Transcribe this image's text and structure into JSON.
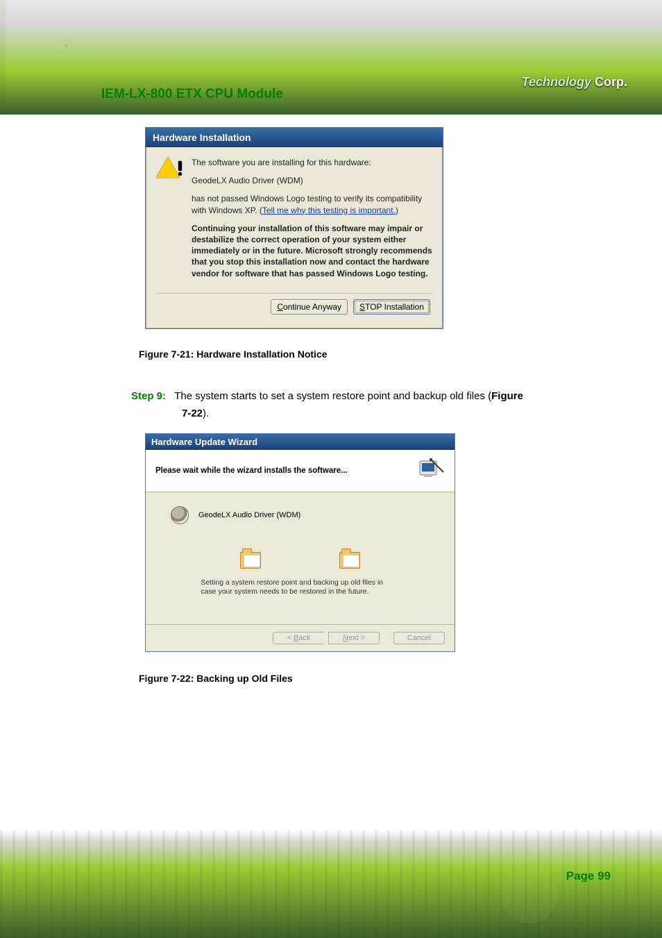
{
  "header": {
    "title": "IEM-LX-800 ETX CPU Module",
    "brand_prefix": "Technology",
    "brand_suffix": " Corp."
  },
  "dialog1": {
    "title": "Hardware Installation",
    "line1": "The software you are installing for this hardware:",
    "driver_name": "GeodeLX Audio Driver (WDM)",
    "line2a": "has not passed Windows Logo testing to verify its compatibility with Windows XP. (",
    "link": "Tell me why this testing is important.",
    "line2b": ")",
    "warning_bold": "Continuing your installation of this software may impair or destabilize the correct operation of your system either immediately or in the future. Microsoft strongly recommends that you stop this installation now and contact the hardware vendor for software that has passed Windows Logo testing.",
    "btn_continue": "Continue Anyway",
    "btn_stop": "STOP Installation"
  },
  "caption1": "Figure 7-21: Hardware Installation Notice",
  "step": {
    "label": "Step 9:",
    "text_a": "The system starts to set a system restore point and backup old files (",
    "fig_ref": "Figure",
    "text_b": "7-22",
    "text_c": ")."
  },
  "wizard": {
    "title": "Hardware Update Wizard",
    "head": "Please wait while the wizard installs the software...",
    "driver": "GeodeLX Audio Driver (WDM)",
    "note": "Setting a system restore point and backing up old files in case your system needs to be restored in the future.",
    "btn_back": "< Back",
    "btn_next": "Next >",
    "btn_cancel": "Cancel"
  },
  "caption2": "Figure 7-22: Backing up Old Files",
  "footer": {
    "page": "Page 99"
  }
}
